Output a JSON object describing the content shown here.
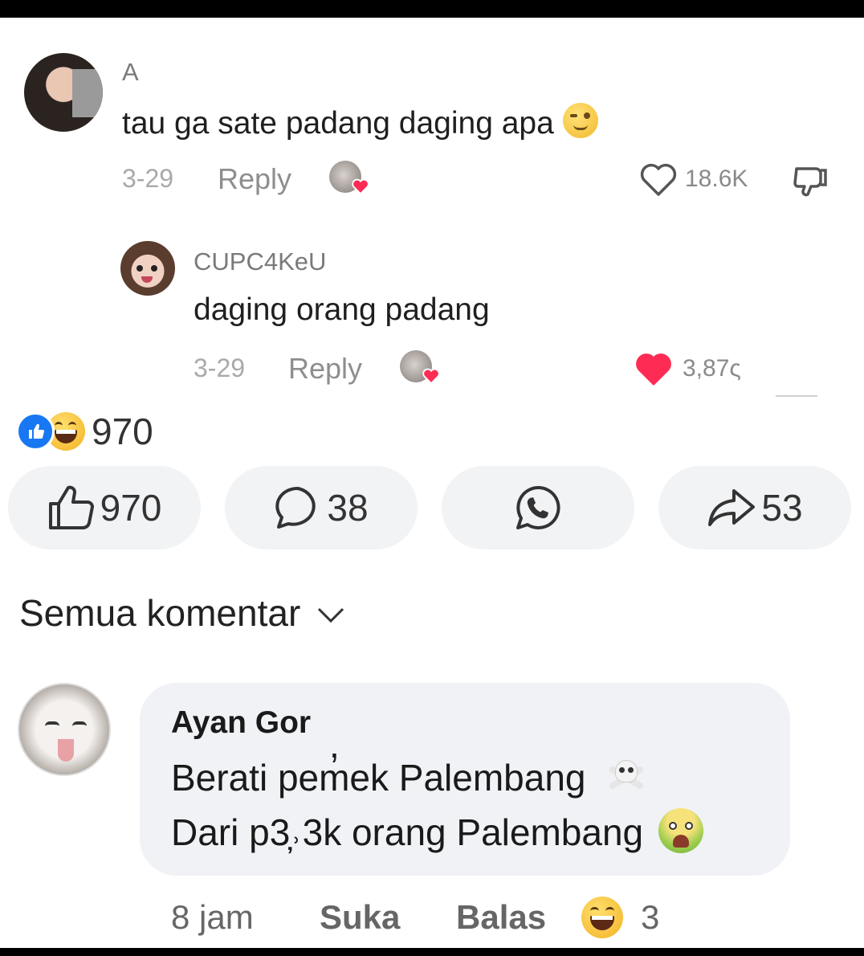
{
  "tiktok": {
    "comment": {
      "user": "A",
      "text": "tau ga sate padang daging apa",
      "date": "3-29",
      "reply_label": "Reply",
      "likes": "18.6K"
    },
    "reply": {
      "user": "CUPC4KeU",
      "text": "daging orang padang",
      "date": "3-29",
      "reply_label": "Reply",
      "likes": "3,87ς"
    }
  },
  "facebook": {
    "reactions_count": "970",
    "actions": {
      "like_count": "970",
      "comment_count": "38",
      "share_count": "53"
    },
    "filter_label": "Semua komentar",
    "comment": {
      "author": "Ayan Gor",
      "line1": "Berati pem̓ek Palembang",
      "line2": "Dari p3̦˒3k orang Palembang",
      "time": "8 jam",
      "like_label": "Suka",
      "reply_label": "Balas",
      "reaction_count": "3"
    }
  },
  "colors": {
    "fb_blue": "#1877f2",
    "tiktok_red": "#fe2c55",
    "emoji_yellow": "#f7c531"
  },
  "icons": [
    "heart-icon",
    "dislike-icon",
    "like-icon",
    "comment-icon",
    "whatsapp-icon",
    "share-icon",
    "chevron-down-icon",
    "skull-crossbones-icon",
    "nauseated-face-icon",
    "laughing-face-icon",
    "winking-face-icon"
  ]
}
